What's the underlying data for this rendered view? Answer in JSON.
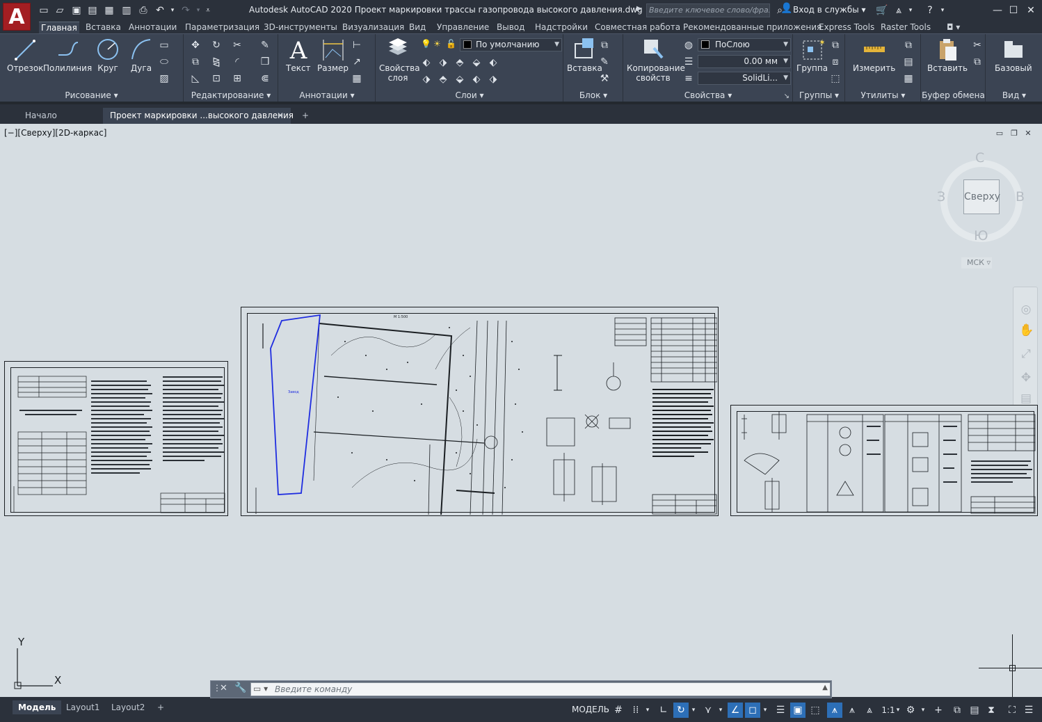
{
  "app": {
    "logo_letter": "A",
    "title": "Autodesk AutoCAD 2020   Проект маркировки трассы газопровода высокого давления.dwg",
    "search_placeholder": "Введите ключевое слово/фразу",
    "signin": "Вход в службы",
    "colors": {
      "brand": "#a31e22",
      "chrome": "#2b313b",
      "ribbon": "#3b4453",
      "canvas": "#d6dde2",
      "accent": "#2d6fb7",
      "selection": "#1f2de0"
    }
  },
  "ribbon_tabs": [
    "Главная",
    "Вставка",
    "Аннотации",
    "Параметризация",
    "3D-инструменты",
    "Визуализация",
    "Вид",
    "Управление",
    "Вывод",
    "Надстройки",
    "Совместная работа",
    "Рекомендованные приложения",
    "Express Tools",
    "Raster Tools"
  ],
  "ribbon": {
    "draw": {
      "title": "Рисование",
      "line": "Отрезок",
      "polyline": "Полилиния",
      "circle": "Круг",
      "arc": "Дуга"
    },
    "modify": {
      "title": "Редактирование"
    },
    "annotation": {
      "title": "Аннотации",
      "text": "Текст",
      "dimension": "Размер"
    },
    "layers": {
      "title": "Слои",
      "layer_props": "Свойства слоя",
      "current_layer": "По умолчанию"
    },
    "block": {
      "title": "Блок",
      "insert": "Вставка"
    },
    "properties": {
      "title": "Свойства",
      "match": "Копирование свойств",
      "color": "ПоСлою",
      "lineweight": "0.00 мм",
      "linetype": "SolidLi..."
    },
    "groups": {
      "title": "Группы",
      "group": "Группа"
    },
    "utilities": {
      "title": "Утилиты",
      "measure": "Измерить"
    },
    "clipboard": {
      "title": "Буфер обмена",
      "paste": "Вставить"
    },
    "view": {
      "title": "Вид",
      "base": "Базовый"
    }
  },
  "doc_tabs": {
    "start": "Начало",
    "current": "Проект маркировки ...высокого давления"
  },
  "viewport": {
    "label": "[−][Сверху][2D-каркас]",
    "viewcube": {
      "face": "Сверху",
      "north": "С",
      "south": "Ю",
      "west": "З",
      "east": "В",
      "wcs": "МСК"
    },
    "ucs": {
      "x": "X",
      "y": "Y"
    },
    "drawing_text": {
      "scale": "М 1:500",
      "zone_label": "Завод"
    }
  },
  "command_line": {
    "placeholder": "Введите  команду"
  },
  "status": {
    "layout_tabs": [
      "Модель",
      "Layout1",
      "Layout2"
    ],
    "model": "МОДЕЛЬ",
    "scale": "1:1"
  }
}
